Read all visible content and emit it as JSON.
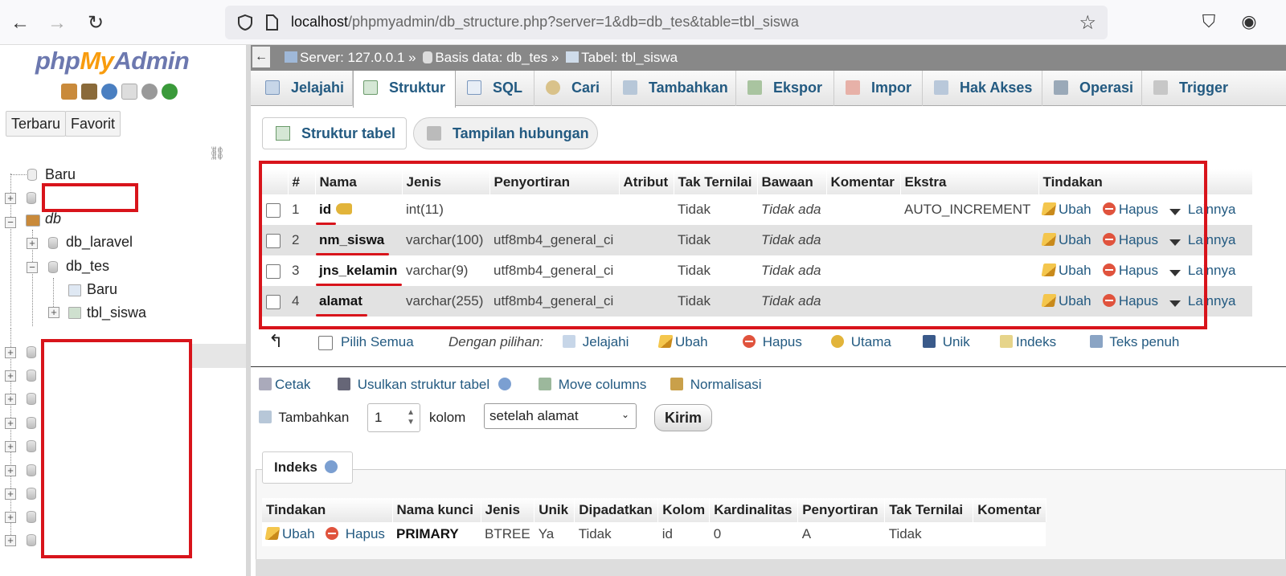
{
  "browser": {
    "url_host": "localhost",
    "url_path": "/phpmyadmin/db_structure.php?server=1&db=db_tes&table=tbl_siswa"
  },
  "sidebar": {
    "logo": {
      "php": "php",
      "my": "My",
      "admin": "Admin"
    },
    "buttons": {
      "recent": "Terbaru",
      "favorites": "Favorit"
    },
    "tree": {
      "new": "Baru",
      "db_group": "db",
      "db_laravel": "db_laravel",
      "db_tes": "db_tes",
      "db_tes_new": "Baru",
      "table": "tbl_siswa"
    }
  },
  "breadcrumb": {
    "server": "Server: 127.0.0.1 »",
    "database": "Basis data: db_tes »",
    "table": "Tabel: tbl_siswa"
  },
  "tabs": [
    "Jelajahi",
    "Struktur",
    "SQL",
    "Cari",
    "Tambahkan",
    "Ekspor",
    "Impor",
    "Hak Akses",
    "Operasi",
    "Trigger"
  ],
  "subtabs": {
    "structure": "Struktur tabel",
    "relation": "Tampilan hubungan"
  },
  "structure": {
    "headers": [
      "#",
      "Nama",
      "Jenis",
      "Penyortiran",
      "Atribut",
      "Tak Ternilai",
      "Bawaan",
      "Komentar",
      "Ekstra",
      "Tindakan"
    ],
    "rows": [
      {
        "num": "1",
        "name": "id",
        "type": "int(11)",
        "collation": "",
        "attr": "",
        "null": "Tidak",
        "default": "Tidak ada",
        "comment": "",
        "extra": "AUTO_INCREMENT"
      },
      {
        "num": "2",
        "name": "nm_siswa",
        "type": "varchar(100)",
        "collation": "utf8mb4_general_ci",
        "attr": "",
        "null": "Tidak",
        "default": "Tidak ada",
        "comment": "",
        "extra": ""
      },
      {
        "num": "3",
        "name": "jns_kelamin",
        "type": "varchar(9)",
        "collation": "utf8mb4_general_ci",
        "attr": "",
        "null": "Tidak",
        "default": "Tidak ada",
        "comment": "",
        "extra": ""
      },
      {
        "num": "4",
        "name": "alamat",
        "type": "varchar(255)",
        "collation": "utf8mb4_general_ci",
        "attr": "",
        "null": "Tidak",
        "default": "Tidak ada",
        "comment": "",
        "extra": ""
      }
    ],
    "actions": {
      "edit": "Ubah",
      "drop": "Hapus",
      "more": "Lainnya"
    }
  },
  "with_selected": {
    "check_all": "Pilih Semua",
    "label": "Dengan pilihan:",
    "browse": "Jelajahi",
    "change": "Ubah",
    "drop": "Hapus",
    "primary": "Utama",
    "unique": "Unik",
    "index": "Indeks",
    "fulltext": "Teks penuh"
  },
  "tools": {
    "print": "Cetak",
    "propose": "Usulkan struktur tabel",
    "move": "Move columns",
    "normalize": "Normalisasi"
  },
  "add_columns": {
    "label": "Tambahkan",
    "count": "1",
    "unit": "kolom",
    "position": "setelah alamat",
    "submit": "Kirim"
  },
  "indexes": {
    "legend": "Indeks",
    "headers": [
      "Tindakan",
      "Nama kunci",
      "Jenis",
      "Unik",
      "Dipadatkan",
      "Kolom",
      "Kardinalitas",
      "Penyortiran",
      "Tak Ternilai",
      "Komentar"
    ],
    "row": {
      "edit": "Ubah",
      "drop": "Hapus",
      "key": "PRIMARY",
      "type": "BTREE",
      "unique": "Ya",
      "packed": "Tidak",
      "column": "id",
      "cardinality": "0",
      "collation": "A",
      "null": "Tidak",
      "comment": ""
    }
  },
  "colors": {
    "link": "#235a81",
    "highlight_red": "#d8141b",
    "logo_blue": "#6c78af",
    "logo_orange": "#f89c0e"
  }
}
